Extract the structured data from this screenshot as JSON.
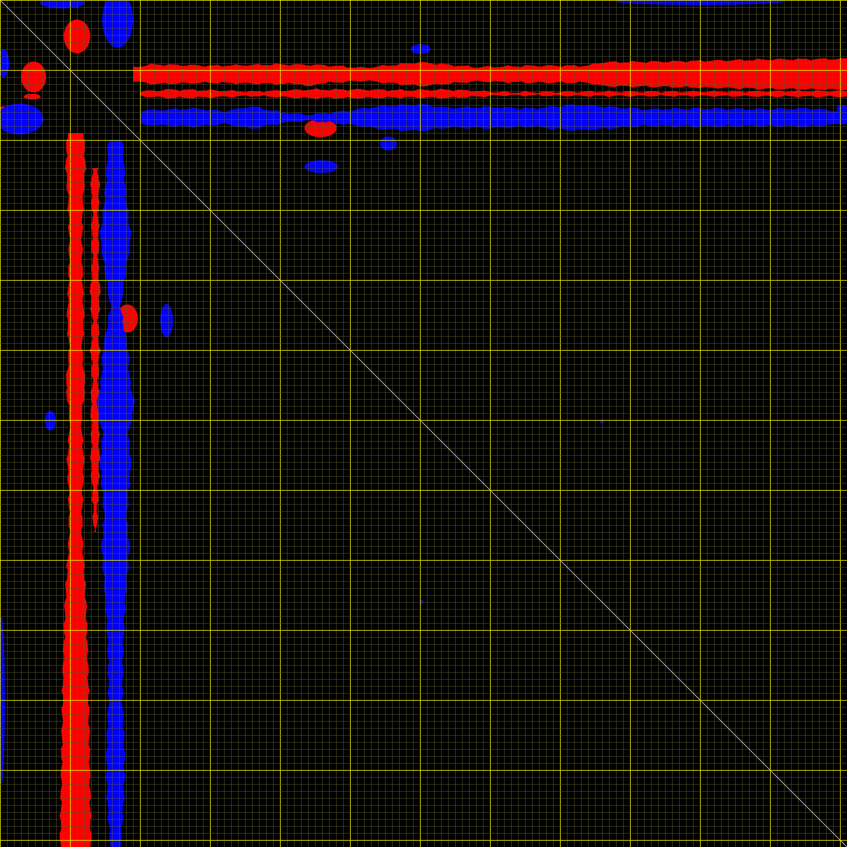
{
  "chart_data": {
    "type": "heatmap",
    "title": "",
    "xlabel": "",
    "ylabel": "",
    "xlim": [
      0,
      121
    ],
    "ylim": [
      0,
      121
    ],
    "grid": true,
    "grid_minor_step": 1,
    "grid_major_step": 10,
    "diagonal": true,
    "legend": "none",
    "colors": {
      "background": "#000000",
      "minor_grid": "#5a5a30",
      "major_grid": "#e8e800",
      "diagonal": "#bdbdbd",
      "positive": "#ff0000",
      "negative": "#0000ff"
    },
    "series": [
      {
        "sign": "positive",
        "regions": [
          {
            "type": "band",
            "axis": "y",
            "center": 10.6,
            "halfwidths": [
              [
                19,
                1.0
              ],
              [
                22,
                1.4
              ],
              [
                30,
                1.2
              ],
              [
                40,
                1.4
              ],
              [
                46,
                1.3
              ],
              [
                52,
                0.9
              ],
              [
                60,
                1.7
              ],
              [
                68,
                1.0
              ],
              [
                76,
                1.2
              ],
              [
                84,
                1.2
              ],
              [
                86,
                1.7
              ],
              [
                95,
                1.8
              ],
              [
                110,
                2.1
              ],
              [
                121,
                2.2
              ]
            ]
          },
          {
            "type": "band",
            "axis": "y",
            "center": 13.4,
            "halfwidths": [
              [
                20,
                0.3
              ],
              [
                24,
                0.6
              ],
              [
                30,
                0.5
              ],
              [
                36,
                0.3
              ],
              [
                44,
                0.6
              ],
              [
                52,
                0.6
              ],
              [
                58,
                0.5
              ],
              [
                64,
                0.6
              ],
              [
                72,
                0.2
              ],
              [
                84,
                0.3
              ],
              [
                100,
                0.3
              ],
              [
                116,
                0.4
              ],
              [
                121,
                0.4
              ]
            ]
          },
          {
            "type": "band",
            "axis": "x",
            "center": 10.8,
            "halfwidths": [
              [
                19,
                1.2
              ],
              [
                24,
                1.4
              ],
              [
                28,
                1.1
              ],
              [
                34,
                0.9
              ],
              [
                40,
                1.0
              ],
              [
                46,
                1.2
              ],
              [
                50,
                0.9
              ],
              [
                55,
                1.4
              ],
              [
                60,
                0.8
              ],
              [
                66,
                1.2
              ],
              [
                70,
                1.0
              ],
              [
                76,
                0.9
              ],
              [
                86,
                1.5
              ],
              [
                96,
                1.8
              ],
              [
                108,
                2.0
              ],
              [
                121,
                2.2
              ]
            ]
          },
          {
            "type": "band",
            "axis": "x",
            "center": 13.6,
            "halfwidths": [
              [
                24,
                0.4
              ],
              [
                27,
                0.6
              ],
              [
                30,
                0.4
              ],
              [
                34,
                0.5
              ],
              [
                38,
                0.4
              ],
              [
                42,
                0.7
              ],
              [
                46,
                0.4
              ],
              [
                50,
                0.6
              ],
              [
                54,
                0.4
              ],
              [
                58,
                0.6
              ],
              [
                62,
                0.5
              ],
              [
                66,
                0.6
              ],
              [
                70,
                0.4
              ],
              [
                76,
                0.2
              ]
            ]
          },
          {
            "type": "blob",
            "cx": 11.0,
            "cy": 5.2,
            "rx": 1.9,
            "ry": 2.4
          },
          {
            "type": "blob",
            "cx": 4.8,
            "cy": 11.0,
            "rx": 1.8,
            "ry": 2.2
          },
          {
            "type": "blob",
            "cx": 45.8,
            "cy": 18.3,
            "rx": 2.3,
            "ry": 1.3
          },
          {
            "type": "blob",
            "cx": 18.2,
            "cy": 45.5,
            "rx": 1.5,
            "ry": 2.0
          },
          {
            "type": "blob",
            "cx": 0.6,
            "cy": 15.8,
            "rx": 0.8,
            "ry": 0.6
          },
          {
            "type": "blob",
            "cx": 4.6,
            "cy": 13.8,
            "rx": 1.2,
            "ry": 0.4
          },
          {
            "type": "blob",
            "cx": 44.1,
            "cy": 11.9,
            "rx": 1.0,
            "ry": 0.4
          }
        ]
      },
      {
        "sign": "negative",
        "regions": [
          {
            "type": "band",
            "axis": "y",
            "center": 16.8,
            "halfwidths": [
              [
                20,
                1.0
              ],
              [
                28,
                1.3
              ],
              [
                32,
                0.9
              ],
              [
                36,
                1.6
              ],
              [
                40,
                0.8
              ],
              [
                44,
                0.4
              ],
              [
                50,
                1.0
              ],
              [
                54,
                1.6
              ],
              [
                60,
                1.9
              ],
              [
                64,
                1.4
              ],
              [
                70,
                1.5
              ],
              [
                76,
                1.3
              ],
              [
                82,
                1.8
              ],
              [
                86,
                1.6
              ],
              [
                92,
                1.2
              ],
              [
                100,
                1.3
              ],
              [
                108,
                1.2
              ],
              [
                116,
                1.3
              ],
              [
                121,
                0.8
              ]
            ]
          },
          {
            "type": "band",
            "axis": "x",
            "center": 16.5,
            "halfwidths": [
              [
                20,
                1.0
              ],
              [
                28,
                1.5
              ],
              [
                34,
                2.2
              ],
              [
                38,
                1.6
              ],
              [
                44,
                0.7
              ],
              [
                50,
                1.8
              ],
              [
                54,
                2.0
              ],
              [
                58,
                2.7
              ],
              [
                62,
                1.8
              ],
              [
                66,
                2.2
              ],
              [
                70,
                1.9
              ],
              [
                74,
                1.6
              ],
              [
                78,
                2.0
              ],
              [
                82,
                1.7
              ],
              [
                86,
                1.4
              ],
              [
                92,
                1.1
              ],
              [
                100,
                1.0
              ],
              [
                108,
                1.3
              ],
              [
                114,
                1.2
              ],
              [
                121,
                0.7
              ]
            ]
          },
          {
            "type": "blob",
            "cx": 16.8,
            "cy": 2.8,
            "rx": 2.2,
            "ry": 4.0
          },
          {
            "type": "blob",
            "cx": 2.8,
            "cy": 17.0,
            "rx": 3.4,
            "ry": 2.2
          },
          {
            "type": "blob",
            "cx": 0.5,
            "cy": 9.0,
            "rx": 0.8,
            "ry": 2.0
          },
          {
            "type": "blob",
            "cx": 8.9,
            "cy": 0.4,
            "rx": 3.2,
            "ry": 0.8
          },
          {
            "type": "blob",
            "cx": 60.1,
            "cy": 7.0,
            "rx": 1.4,
            "ry": 0.7
          },
          {
            "type": "blob",
            "cx": 45.9,
            "cy": 23.8,
            "rx": 2.4,
            "ry": 0.9
          },
          {
            "type": "blob",
            "cx": 23.8,
            "cy": 45.8,
            "rx": 0.9,
            "ry": 2.4
          },
          {
            "type": "blob",
            "cx": 7.2,
            "cy": 60.1,
            "rx": 0.8,
            "ry": 1.4
          },
          {
            "type": "blob",
            "cx": 55.5,
            "cy": 20.5,
            "rx": 1.2,
            "ry": 1.0
          },
          {
            "type": "blob",
            "cx": 120.3,
            "cy": 15.5,
            "rx": 0.8,
            "ry": 0.5
          },
          {
            "type": "blob",
            "cx": 100.0,
            "cy": 0.2,
            "rx": 12.0,
            "ry": 0.5
          },
          {
            "type": "blob",
            "cx": 0.2,
            "cy": 100.0,
            "rx": 0.5,
            "ry": 12.0
          },
          {
            "type": "blob",
            "cx": 86.0,
            "cy": 60.2,
            "rx": 0.3,
            "ry": 0.3
          },
          {
            "type": "blob",
            "cx": 60.2,
            "cy": 86.0,
            "rx": 0.3,
            "ry": 0.3
          }
        ]
      }
    ]
  }
}
